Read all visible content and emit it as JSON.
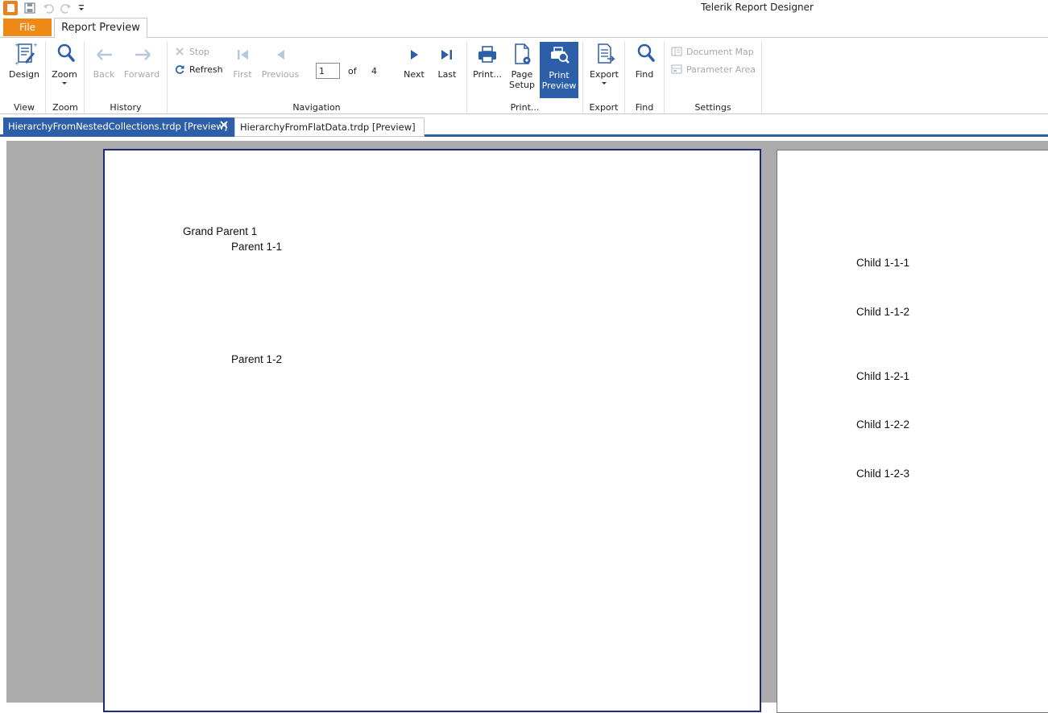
{
  "window": {
    "title": "Telerik Report Designer"
  },
  "qat": {
    "save_icon": "save-icon",
    "undo_icon": "undo-icon",
    "redo_icon": "redo-icon",
    "customize_icon": "customize-qat-icon"
  },
  "ribbon_tabs": {
    "file": "File",
    "report_preview": "Report Preview"
  },
  "groups": {
    "view": {
      "label": "View",
      "design": "Design"
    },
    "zoom": {
      "label": "Zoom",
      "zoom": "Zoom"
    },
    "history": {
      "label": "History",
      "back": "Back",
      "forward": "Forward"
    },
    "navigation": {
      "label": "Navigation",
      "stop": "Stop",
      "refresh": "Refresh",
      "first": "First",
      "previous": "Previous",
      "page_value": "1",
      "of": "of",
      "total": "4",
      "next": "Next",
      "last": "Last"
    },
    "print": {
      "label": "Print...",
      "print": "Print...",
      "page_setup_1": "Page",
      "page_setup_2": "Setup",
      "print_preview_1": "Print",
      "print_preview_2": "Preview"
    },
    "export": {
      "label": "Export",
      "export": "Export"
    },
    "find": {
      "label": "Find",
      "find": "Find"
    },
    "settings": {
      "label": "Settings",
      "document_map": "Document Map",
      "parameter_area": "Parameter Area"
    }
  },
  "document_tabs": [
    {
      "label": "HierarchyFromNestedCollections.trdp [Preview]",
      "active": true
    },
    {
      "label": "HierarchyFromFlatData.trdp [Preview]",
      "active": false
    }
  ],
  "report": {
    "page1": [
      "Grand Parent 1",
      "Parent 1-1",
      "Parent 1-2"
    ],
    "page2": [
      "Child 1-1-1",
      "Child 1-1-2",
      "Child 1-2-1",
      "Child 1-2-2",
      "Child 1-2-3"
    ]
  },
  "colors": {
    "file_tab": "#f08a16",
    "accent": "#2d5fa8",
    "viewer_bg": "#ababab",
    "page_border": "#1f2a7a"
  }
}
